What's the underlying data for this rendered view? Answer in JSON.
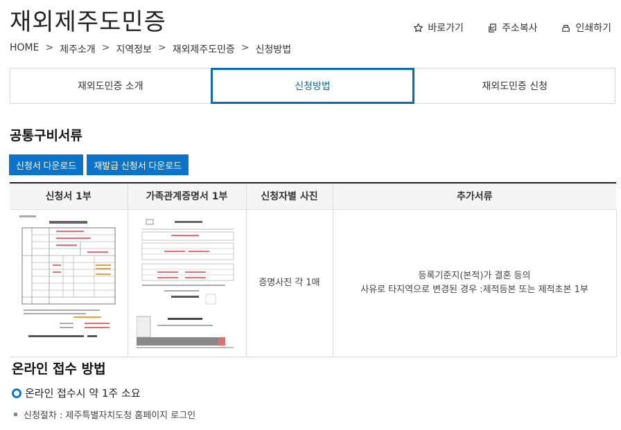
{
  "page": {
    "title": "재외제주도민증"
  },
  "utility": {
    "shortcut": "바로가기",
    "copy_address": "주소복사",
    "print": "인쇄하기"
  },
  "breadcrumb": {
    "home": "HOME",
    "items": [
      "제주소개",
      "지역정보",
      "재외제주도민증",
      "신청방법"
    ],
    "separator": ">"
  },
  "tabs": [
    {
      "label": "재외도민증 소개",
      "active": false
    },
    {
      "label": "신청방법",
      "active": true
    },
    {
      "label": "재외도민증 신청",
      "active": false
    }
  ],
  "common_docs": {
    "title": "공통구비서류",
    "btn_application_download": "신청서 다운로드",
    "btn_reissue_download": "재발급 신청서 다운로드",
    "table": {
      "headers": [
        "신청서 1부",
        "가족관계증명서 1부",
        "신청자별 사진",
        "추가서류"
      ],
      "photo": "증명사진 각 1매",
      "extra_line1": "등록기준지(본적)가 결혼 등의",
      "extra_line2": "사유로 타지역으로 변경된 경우 :제적등본 또는 제적초본 1부"
    }
  },
  "online": {
    "title": "온라인 접수 방법",
    "bullet": "온라인 접수시 약 1주 소요",
    "sub": "신청절차 : 제주특별자치도청 홈페이지 로그인"
  },
  "colors": {
    "accent": "#0b73c8",
    "tab_active": "#0a6aa8"
  },
  "icons": {
    "shortcut": "star-icon",
    "copy": "copy-icon",
    "print": "print-icon"
  }
}
